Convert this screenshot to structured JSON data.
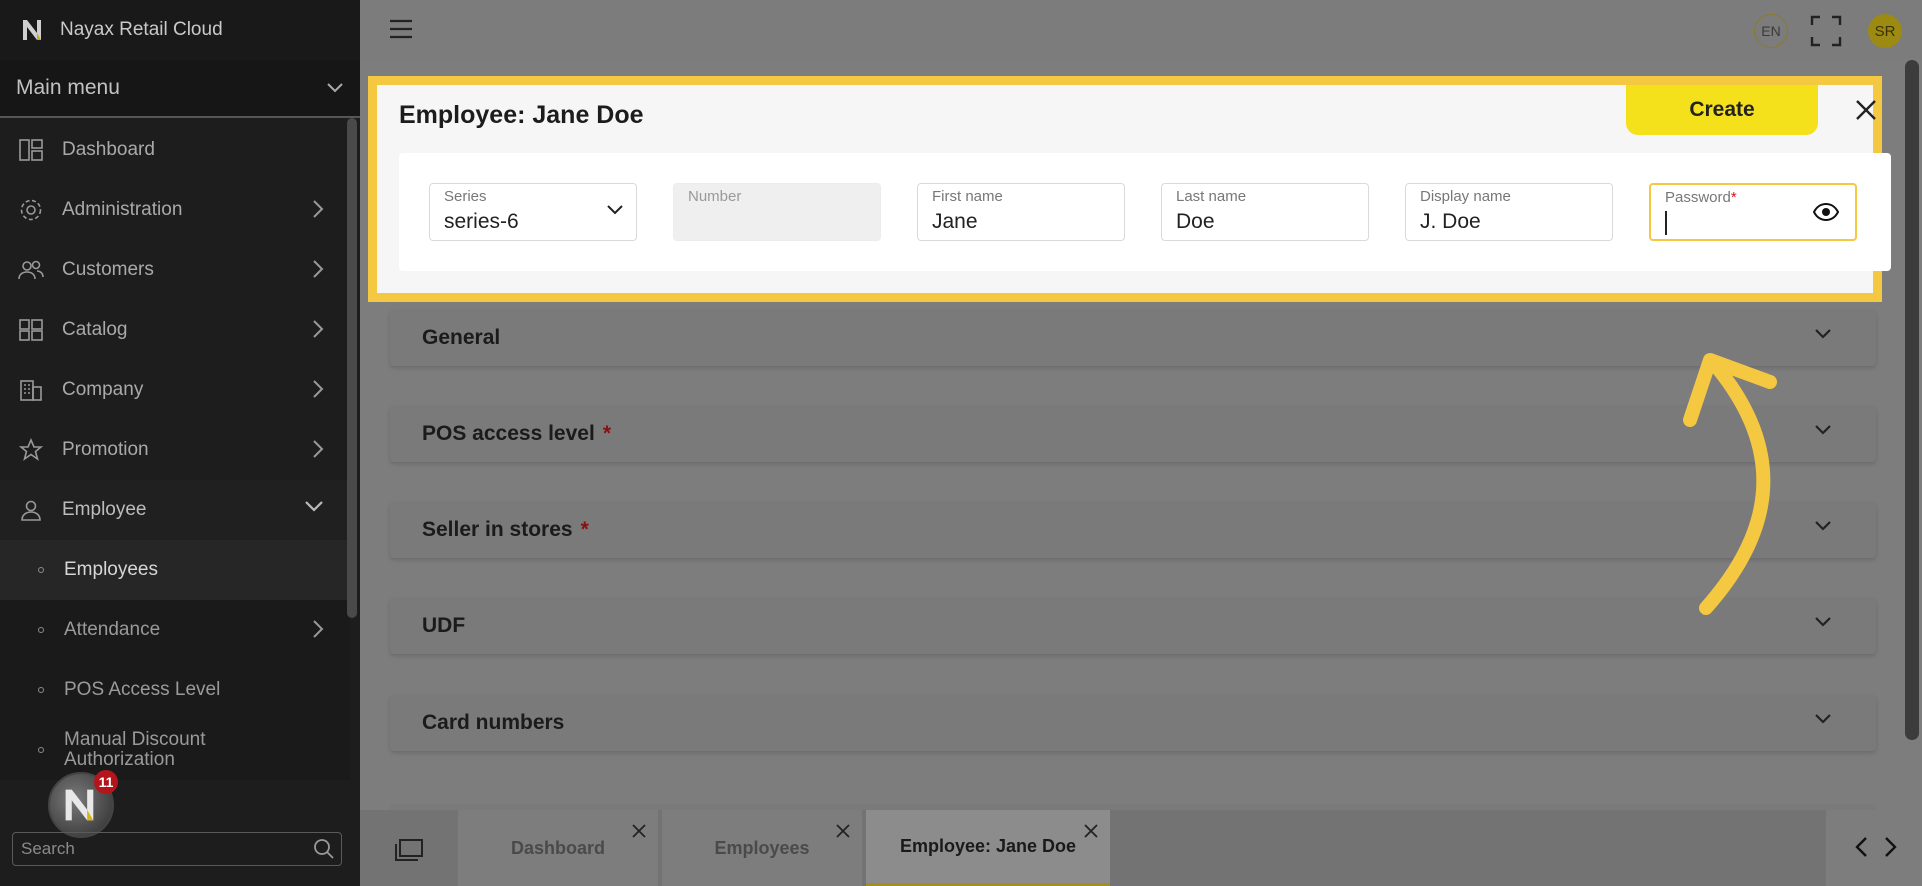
{
  "app": {
    "brand": "Nayax Retail Cloud",
    "main_menu_label": "Main menu"
  },
  "sidebar": {
    "items": [
      {
        "label": "Dashboard",
        "icon": "dashboard-icon"
      },
      {
        "label": "Administration",
        "icon": "gear-icon"
      },
      {
        "label": "Customers",
        "icon": "users-icon"
      },
      {
        "label": "Catalog",
        "icon": "grid-icon"
      },
      {
        "label": "Company",
        "icon": "building-icon"
      },
      {
        "label": "Promotion",
        "icon": "star-icon"
      },
      {
        "label": "Employee",
        "icon": "person-icon"
      }
    ],
    "employee_sub": [
      {
        "label": "Employees"
      },
      {
        "label": "Attendance"
      },
      {
        "label": "POS Access Level"
      },
      {
        "label": "Manual Discount Authorization"
      }
    ],
    "search_placeholder": "Search",
    "notification_count": "11"
  },
  "topbar": {
    "lang": "EN",
    "avatar_initials": "SR"
  },
  "modal": {
    "title": "Employee: Jane Doe",
    "create_label": "Create",
    "fields": {
      "series": {
        "label": "Series",
        "value": "series-6"
      },
      "number": {
        "label": "Number",
        "value": ""
      },
      "first_name": {
        "label": "First name",
        "value": "Jane"
      },
      "last_name": {
        "label": "Last name",
        "value": "Doe"
      },
      "display_name": {
        "label": "Display name",
        "value": "J. Doe"
      },
      "password": {
        "label": "Password",
        "required_mark": "*",
        "value": ""
      }
    }
  },
  "sections": [
    {
      "title": "General",
      "required": ""
    },
    {
      "title": "POS access level",
      "required": "*"
    },
    {
      "title": "Seller in stores",
      "required": "*"
    },
    {
      "title": "UDF",
      "required": ""
    },
    {
      "title": "Card numbers",
      "required": ""
    }
  ],
  "tabs": [
    {
      "label": "Dashboard"
    },
    {
      "label": "Employees"
    },
    {
      "label": "Employee: Jane Doe",
      "active": true
    }
  ],
  "colors": {
    "accent_yellow": "#f5c842",
    "button_yellow": "#f5e01c",
    "required_red": "#d3141a"
  }
}
